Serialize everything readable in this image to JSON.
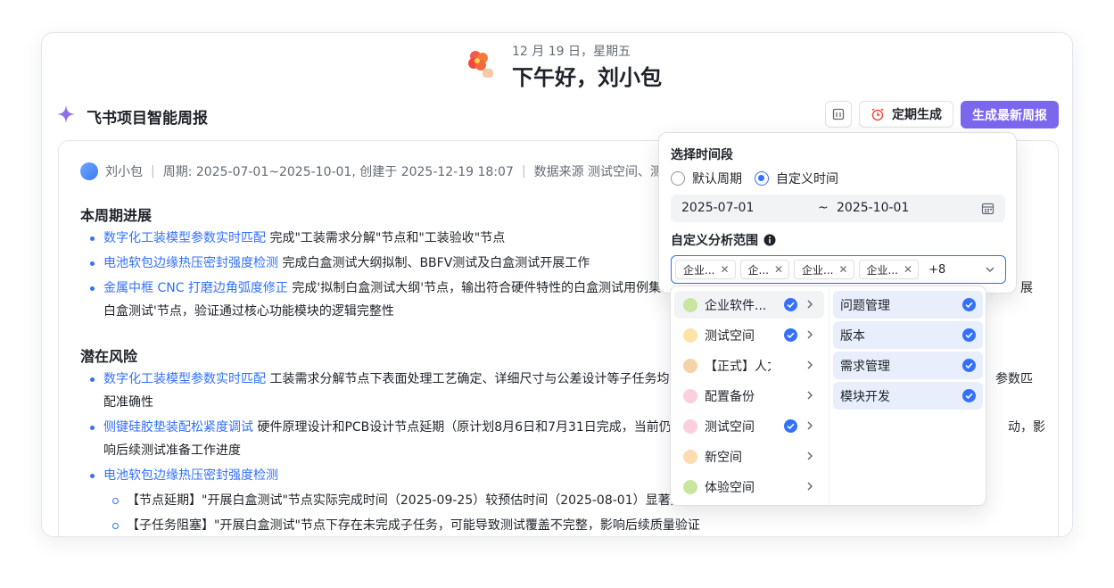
{
  "greeting": {
    "date": "12 月 19 日，星期五",
    "title": "下午好，刘小包"
  },
  "header": {
    "title": "飞书项目智能周报",
    "schedule_label": "定期生成",
    "generate_label": "生成最新周报"
  },
  "meta": {
    "user": "刘小包",
    "period": "周期: 2025-07-01~2025-10-01, 创建于 2025-12-19 18:07",
    "source": "数据来源 测试空间、测试空"
  },
  "sections": {
    "progress": {
      "title": "本周期进展",
      "items": [
        {
          "link": "数字化工装模型参数实时匹配",
          "text": " 完成\"工装需求分解\"节点和\"工装验收\"节点"
        },
        {
          "link": "电池软包边缘热压密封强度检测",
          "text": " 完成白盒测试大纲拟制、BBFV测试及白盒测试开展工作"
        },
        {
          "link": "金属中框 CNC 打磨边角弧度修正",
          "text": " 完成'拟制白盒测试大纲'节点，输出符合硬件特性的白盒测试用例集",
          "tail": "展",
          "line2": "白盒测试'节点，验证通过核心功能模块的逻辑完整性"
        }
      ]
    },
    "risks": {
      "title": "潜在风险",
      "items": [
        {
          "link": "数字化工装模型参数实时匹配",
          "text": " 工装需求分解节点下表面处理工艺确定、详细尺寸与公差设计等子任务均",
          "tail": "参数匹",
          "line2": "配准确性"
        },
        {
          "link": "侧键硅胶垫装配松紧度调试",
          "text": " 硬件原理设计和PCB设计节点延期（原计划8月6日和7月31日完成，当前仍",
          "tail": "动，影",
          "line2": "响后续测试准备工作进度"
        },
        {
          "link": "电池软包边缘热压密封强度检测",
          "text": ""
        }
      ],
      "sub_items": [
        "【节点延期】\"开展白盒测试\"节点实际完成时间（2025-09-25）较预估时间（2025-08-01）显著延",
        "【子任务阻塞】\"开展白盒测试\"节点下存在未完成子任务，可能导致测试覆盖不完整，影响后续质量验证"
      ]
    }
  },
  "popover": {
    "time_label": "选择时间段",
    "radio_default": "默认周期",
    "radio_custom": "自定义时间",
    "start_date": "2025-07-01",
    "tilde": "~",
    "end_date": "2025-10-01",
    "scope_label": "自定义分析范围",
    "tags": [
      "企业...",
      "企...",
      "企业...",
      "企业..."
    ],
    "more": "+8"
  },
  "cascader": {
    "left": [
      {
        "label": "企业软件...",
        "checked": true,
        "icon_color": "#c8e6a0"
      },
      {
        "label": "测试空间",
        "checked": true,
        "icon_color": "#ffe2a8"
      },
      {
        "label": "【正式】人力...",
        "checked": false,
        "icon_color": "#f6d3a6"
      },
      {
        "label": "配置备份",
        "checked": false,
        "icon_color": "#fbd0dc"
      },
      {
        "label": "测试空间",
        "checked": true,
        "icon_color": "#fbd0dc"
      },
      {
        "label": "新空间",
        "checked": false,
        "icon_color": "#ffdcb0"
      },
      {
        "label": "体验空间",
        "checked": false,
        "icon_color": "#c8e6a0"
      }
    ],
    "right": [
      "问题管理",
      "版本",
      "需求管理",
      "模块开发"
    ]
  },
  "colors": {
    "accent": "#7b67ee",
    "link": "#3370ff",
    "check": "#3370ff"
  }
}
